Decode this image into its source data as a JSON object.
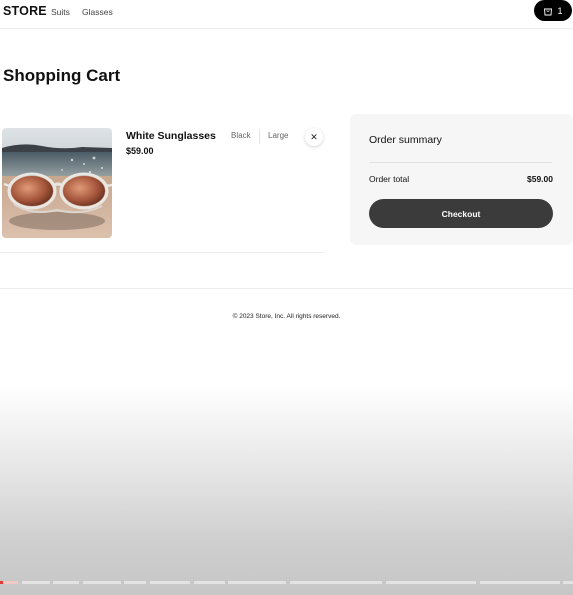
{
  "nav": {
    "logo": "STORE",
    "links": [
      "Suits",
      "Glasses"
    ],
    "cart_count": "1"
  },
  "page": {
    "title": "Shopping Cart"
  },
  "cart": {
    "items": [
      {
        "name": "White Sunglasses",
        "price": "$59.00",
        "color": "Black",
        "size": "Large",
        "remove_symbol": "✕"
      }
    ]
  },
  "summary": {
    "title": "Order summary",
    "total_label": "Order total",
    "total_value": "$59.00",
    "checkout_label": "Checkout"
  },
  "footer": {
    "text": "© 2023 Store, Inc. All rights reserved."
  },
  "colors": {
    "accent": "#000000",
    "checkout": "#3b3b3b",
    "panel": "#f6f6f7",
    "progress_active": "#e53935"
  },
  "icons": {
    "cart": "shopping-bag-icon",
    "remove": "close-icon"
  },
  "progress": {
    "value": 0.03
  }
}
